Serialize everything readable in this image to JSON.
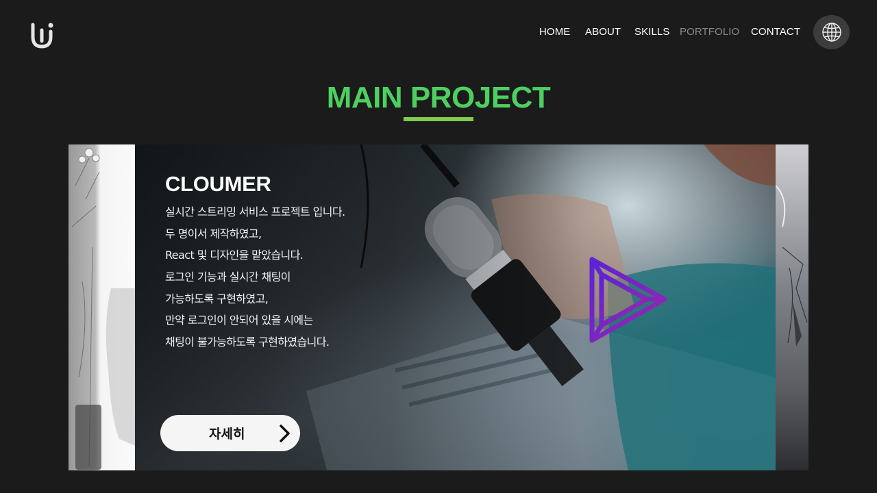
{
  "header": {
    "logo": "logo-icon",
    "nav": [
      {
        "label": "HOME"
      },
      {
        "label": "ABOUT"
      },
      {
        "label": "SKILLS"
      },
      {
        "label": "PORTFOLIO"
      },
      {
        "label": "CONTACT"
      }
    ],
    "active_nav": "PORTFOLIO",
    "language_button_icon": "globe-icon"
  },
  "section": {
    "title": "MAIN PROJECT",
    "accent_color": "#4ed061"
  },
  "slide": {
    "title": "CLOUMER",
    "description": [
      "실시간 스트리밍 서비스 프로젝트 입니다.",
      "두 명이서 제작하였고,",
      "React 및 디자인을 맡았습니다.",
      "로그인 기능과 실시간 채팅이",
      "가능하도록 구현하였고,",
      "만약 로그인이 안되어 있을 시에는",
      " 채팅이 불가능하도록 구현하였습니다."
    ],
    "detail_button": "자세히",
    "detail_icon": "chevron-right-icon",
    "brand_icon": "play-logo-icon"
  }
}
